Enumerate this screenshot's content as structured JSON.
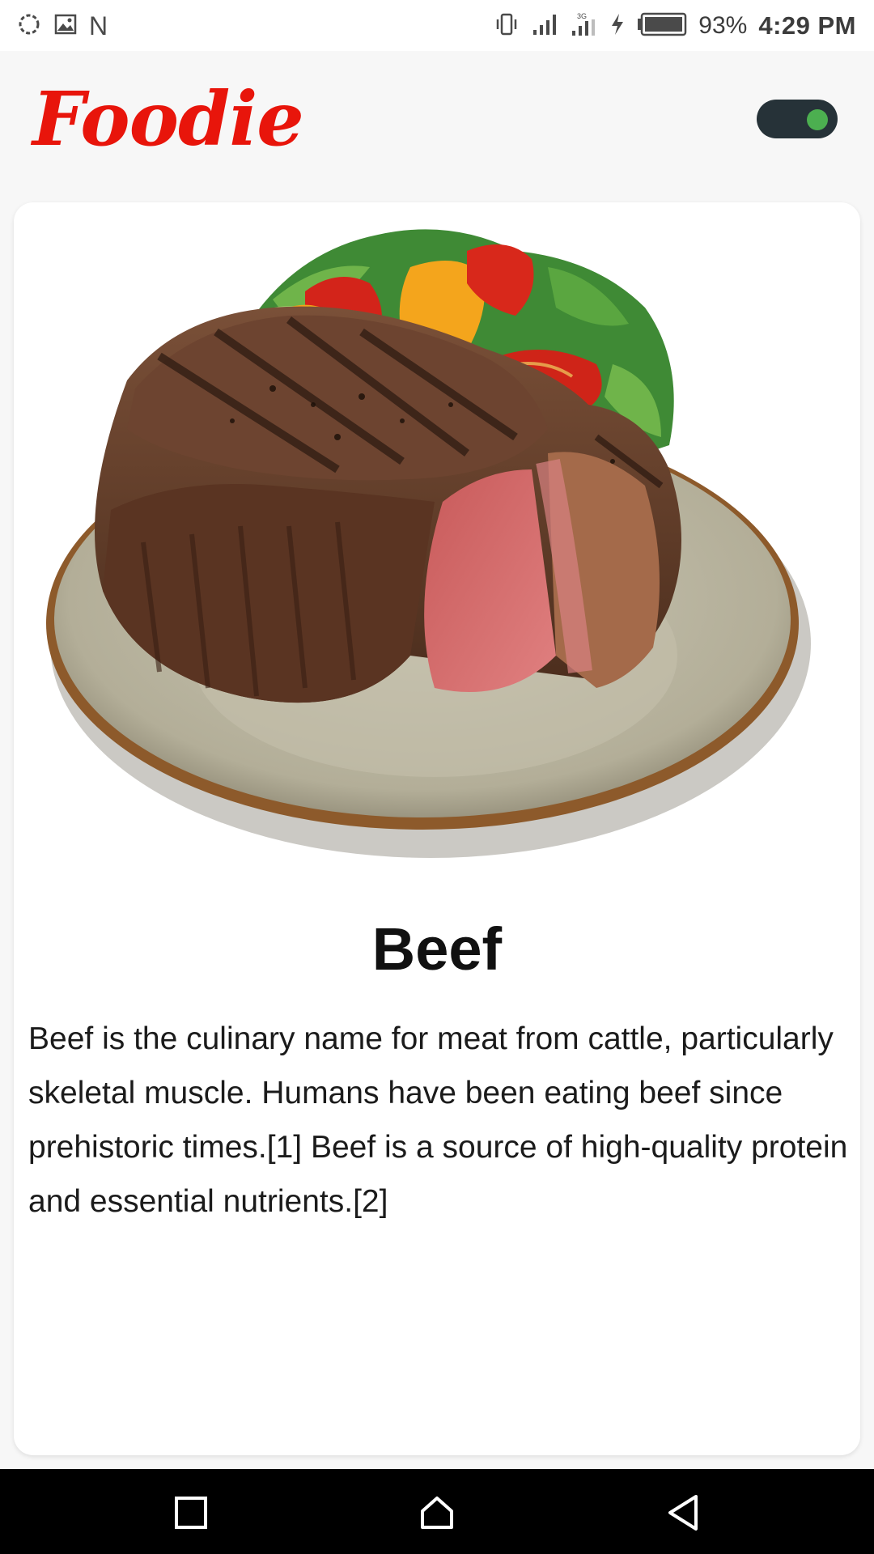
{
  "status_bar": {
    "left_icons": [
      "sync-icon",
      "image-icon"
    ],
    "carrier_letter": "N",
    "right_icons": [
      "vibrate-icon",
      "signal-icon",
      "signal-3g-icon",
      "charging-icon",
      "battery-icon"
    ],
    "battery_percent": "93%",
    "time": "4:29 PM"
  },
  "app_bar": {
    "title": "Foodie",
    "toggle_on": true,
    "colors": {
      "title": "#e8150b",
      "toggle_track": "#263238",
      "toggle_knob": "#4caf50"
    }
  },
  "card": {
    "image_icon": "beef-steak-plate",
    "title": "Beef",
    "description": "Beef is the culinary name for meat from cattle, particularly skeletal muscle. Humans have been eating beef since prehistoric times.[1] Beef is a source of high-quality protein and essential nutrients.[2]"
  },
  "nav_bar": {
    "buttons": [
      "recents-icon",
      "home-icon",
      "back-icon"
    ]
  }
}
